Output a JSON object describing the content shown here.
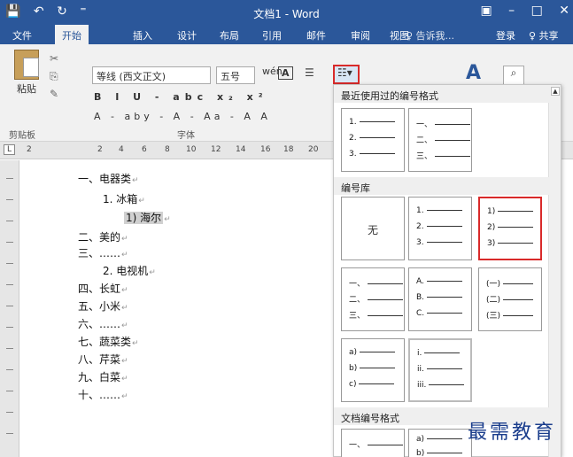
{
  "window": {
    "title": "文档1 - Word",
    "quick_access": [
      "💾",
      "↶",
      "↻",
      "⁼"
    ],
    "controls": [
      "▣",
      "–",
      "□",
      "✕"
    ]
  },
  "tabs": [
    {
      "label": "文件"
    },
    {
      "label": "开始"
    },
    {
      "label": "插入"
    },
    {
      "label": "设计"
    },
    {
      "label": "布局"
    },
    {
      "label": "引用"
    },
    {
      "label": "邮件"
    },
    {
      "label": "审阅"
    },
    {
      "label": "视图"
    }
  ],
  "tellme": "♀ 告诉我...",
  "login": "登录",
  "share": "♀ 共享",
  "ribbon": {
    "paste_label": "粘贴",
    "clipboard_group": "剪贴板",
    "font_name": "等线 (西文正文)",
    "font_size": "五号",
    "font_row2": "B I U - abc x₂ x²",
    "font_row3": "A - aby - A - Aa - A A",
    "font_group": "字体",
    "wen": "wén",
    "Abox": "A"
  },
  "ruler": {
    "corner": "L",
    "numbers": [
      "2",
      "2",
      "4",
      "6",
      "8",
      "10",
      "12",
      "14",
      "16",
      "18",
      "20"
    ]
  },
  "document": {
    "lines": [
      "一、电器类",
      "1.  冰箱",
      "1)  海尔",
      "二、美的",
      "三、……",
      "2.  电视机",
      "四、长虹",
      "五、小米",
      "六、……",
      "七、蔬菜类",
      "八、芹菜",
      "九、白菜",
      "十、……"
    ],
    "para_mark": "↵"
  },
  "panel": {
    "recent_title": "最近使用过的编号格式",
    "library_title": "编号库",
    "doc_title": "文档编号格式",
    "none_label": "无",
    "tiles": {
      "recent1": [
        "1.",
        "2.",
        "3."
      ],
      "recent2": [
        "一、",
        "二、",
        "三、"
      ],
      "lib_arabic_dot": [
        "1.",
        "2.",
        "3."
      ],
      "lib_arabic_paren": [
        "1)",
        "2)",
        "3)"
      ],
      "lib_cn": [
        "一、",
        "二、",
        "三、"
      ],
      "lib_upper": [
        "A.",
        "B.",
        "C."
      ],
      "lib_cn_paren": [
        "(一)",
        "(二)",
        "(三)"
      ],
      "lib_lower_paren": [
        "a)",
        "b)",
        "c)"
      ],
      "lib_roman": [
        "i.",
        "ii.",
        "iii."
      ],
      "doc1": [
        "一、"
      ],
      "doc2": [
        "a)",
        "b)"
      ]
    }
  },
  "watermark": "最需教育"
}
